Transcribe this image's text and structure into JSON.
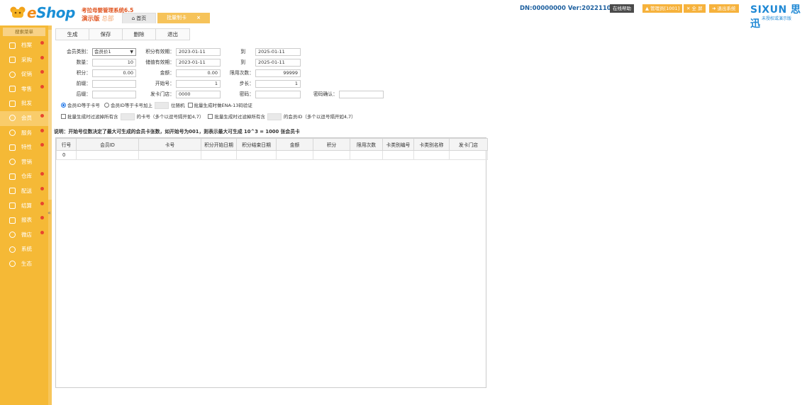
{
  "header": {
    "logo_e": "e",
    "logo_shop": "Shop",
    "system_name": "考拉母婴管理系统6.5",
    "edition": "演示版",
    "edition_hq": "总部",
    "tabs": [
      {
        "label": "首页",
        "icon": "home-icon"
      },
      {
        "label": "批量制卡",
        "close": "×"
      }
    ],
    "version_info": "DN:00000000  Ver:20221109",
    "help_btn": "在线帮助",
    "admin_btn": "▲ 管理员[1001]",
    "fullscreen_btn": "✕ 全 屏",
    "exit_btn": "➜ 退出系统",
    "brand": "SIXUN 思迅",
    "brand_sub": "未授权或演示版"
  },
  "sidebar": {
    "search_label": "搜索菜单",
    "items": [
      {
        "label": "档案",
        "icon": "archive-icon",
        "dot": true
      },
      {
        "label": "采购",
        "icon": "cart-icon",
        "dot": true
      },
      {
        "label": "促销",
        "icon": "promo-icon",
        "dot": true
      },
      {
        "label": "零售",
        "icon": "retail-icon",
        "dot": true
      },
      {
        "label": "批发",
        "icon": "wholesale-icon",
        "dot": false
      },
      {
        "label": "会员",
        "icon": "member-icon",
        "dot": true,
        "active": true
      },
      {
        "label": "服务",
        "icon": "service-icon",
        "dot": true
      },
      {
        "label": "特性",
        "icon": "feature-icon",
        "dot": true
      },
      {
        "label": "营销",
        "icon": "marketing-icon",
        "dot": false
      },
      {
        "label": "仓库",
        "icon": "warehouse-icon",
        "dot": true
      },
      {
        "label": "配送",
        "icon": "delivery-icon",
        "dot": true
      },
      {
        "label": "结算",
        "icon": "settlement-icon",
        "dot": true
      },
      {
        "label": "报表",
        "icon": "report-icon",
        "dot": true
      },
      {
        "label": "微店",
        "icon": "wechat-store-icon",
        "dot": false
      },
      {
        "label": "系统",
        "icon": "system-icon",
        "dot": false
      },
      {
        "label": "生态",
        "icon": "ecology-icon",
        "dot": false
      }
    ],
    "collapse": "«"
  },
  "toolbar": {
    "generate": "生成",
    "save": "保存",
    "delete": "删除",
    "exit": "退出"
  },
  "form": {
    "member_type_label": "会员类别：",
    "member_type_value": "会员价1",
    "points_valid_label": "积分有效期：",
    "points_valid_from": "2023-01-11",
    "to_label_1": "到",
    "points_valid_to": "2025-01-11",
    "quantity_label": "数量：",
    "quantity_value": "10",
    "stored_valid_label": "储值有效期：",
    "stored_valid_from": "2023-01-11",
    "to_label_2": "到",
    "stored_valid_to": "2025-01-11",
    "points_label": "积分：",
    "points_value": "0.00",
    "amount_label": "金额：",
    "amount_value": "0.00",
    "limit_label": "限用次数：",
    "limit_value": "99999",
    "prefix_label": "前缀：",
    "prefix_value": "",
    "start_no_label": "开始号：",
    "start_no_value": "1",
    "step_label": "步长：",
    "step_value": "1",
    "suffix_label": "后缀：",
    "suffix_value": "",
    "issue_store_label": "发卡门店：",
    "issue_store_value": "0000",
    "password_label": "密码：",
    "password_value": "",
    "password_confirm_label": "密码确认：",
    "password_confirm_value": "",
    "radio_card_no": "会员ID等于卡号",
    "radio_card_plus": "会员ID等于卡号加上",
    "random_suffix": "位随机",
    "ean_check": "批量生成时做ENA-13码验证",
    "filter_card_prefix": "批量生成时过滤掉所有含",
    "filter_card_suffix": "的卡号（多个以逗号隔开如4,7）",
    "filter_id_prefix": "批量生成时过滤掉所有含",
    "filter_id_suffix": "的会员ID（多个以逗号隔开如4,7）"
  },
  "note": "说明：开始号位数决定了最大可生成的会员卡张数，如开始号为001，则表示最大可生成 10^3 = 1000 张会员卡",
  "grid": {
    "columns": [
      "行号",
      "会员ID",
      "卡号",
      "积分开始日期",
      "积分结束日期",
      "金额",
      "积分",
      "限用次数",
      "卡类别编号",
      "卡类别名称",
      "发卡门店"
    ],
    "rows": [
      [
        "0",
        "",
        "",
        "",
        "",
        "",
        "",
        "",
        "",
        "",
        ""
      ]
    ]
  }
}
